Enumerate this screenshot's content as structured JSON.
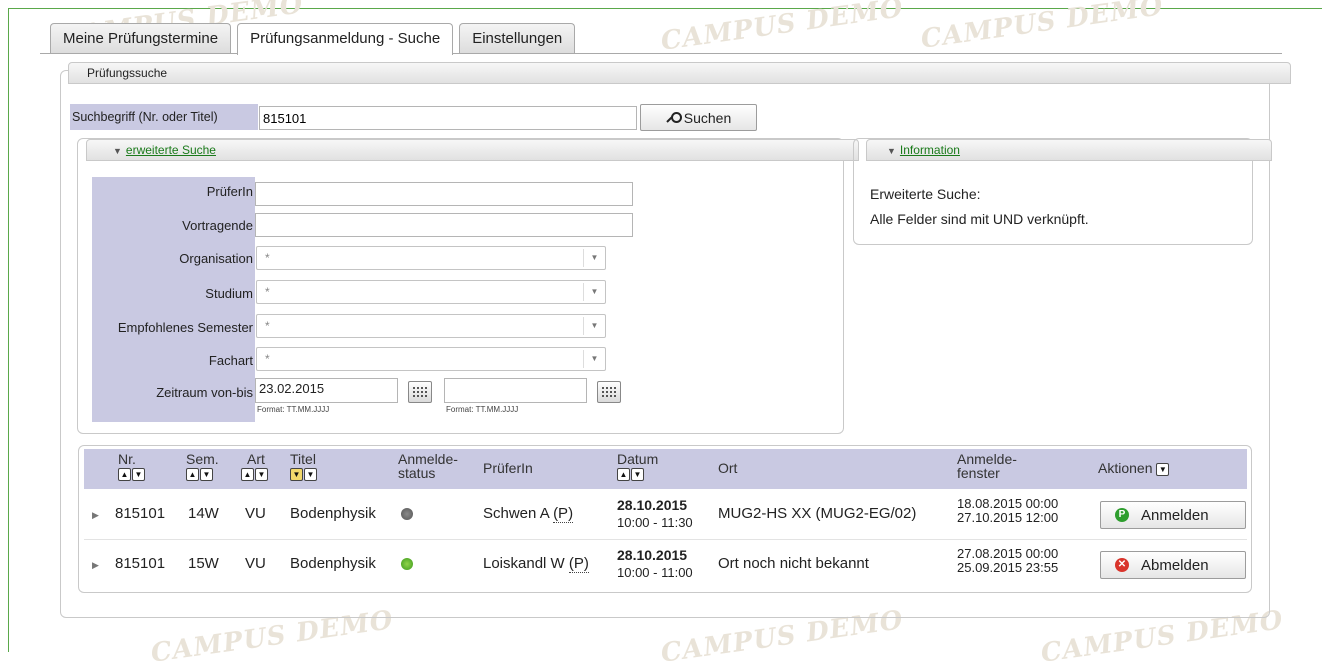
{
  "tabs": [
    {
      "label": "Meine Prüfungstermine"
    },
    {
      "label": "Prüfungsanmeldung - Suche"
    },
    {
      "label": "Einstellungen"
    }
  ],
  "watermark": "CAMPUS DEMO",
  "search_section": {
    "legend": "Prüfungssuche",
    "label": "Suchbegriff (Nr. oder Titel)",
    "value": "815101",
    "button_label": "Suchen"
  },
  "extended": {
    "legend": "erweiterte Suche",
    "labels": {
      "pruefer": "PrüferIn",
      "vortragende": "Vortragende",
      "organisation": "Organisation",
      "studium": "Studium",
      "semester": "Empfohlenes Semester",
      "fachart": "Fachart",
      "zeitraum": "Zeitraum von-bis"
    },
    "select_value": "*",
    "date_from": "23.02.2015",
    "date_to": "",
    "date_format": "Format: TT.MM.JJJJ"
  },
  "info": {
    "legend": "Information",
    "line1": "Erweiterte Suche:",
    "line2": "Alle Felder sind mit UND verknüpft."
  },
  "table": {
    "headers": {
      "nr": "Nr.",
      "sem": "Sem.",
      "art": "Art",
      "titel": "Titel",
      "status1": "Anmelde-",
      "status2": "status",
      "pruefer": "PrüferIn",
      "datum": "Datum",
      "ort": "Ort",
      "fenster1": "Anmelde-",
      "fenster2": "fenster",
      "aktionen": "Aktionen"
    },
    "rows": [
      {
        "nr": "815101",
        "sem": "14W",
        "art": "VU",
        "titel": "Bodenphysik",
        "status": "grey",
        "pruefer": "Schwen A",
        "pruefer_abbr": "(P)",
        "date": "28.10.2015",
        "time": "10:00 - 11:30",
        "ort": "MUG2-HS XX (MUG2-EG/02)",
        "window_start": "18.08.2015 00:00",
        "window_end": "27.10.2015 12:00",
        "action": "Anmelden"
      },
      {
        "nr": "815101",
        "sem": "15W",
        "art": "VU",
        "titel": "Bodenphysik",
        "status": "green",
        "pruefer": "Loiskandl W",
        "pruefer_abbr": "(P)",
        "date": "28.10.2015",
        "time": "10:00 - 11:00",
        "ort": "Ort noch nicht bekannt",
        "window_start": "27.08.2015 00:00",
        "window_end": "25.09.2015 23:55",
        "action": "Abmelden"
      }
    ]
  },
  "colors": {
    "label_bg": "#c9c9e2",
    "link": "#1a7a1a",
    "register": "#2e9e2e",
    "deregister": "#d9342b"
  }
}
